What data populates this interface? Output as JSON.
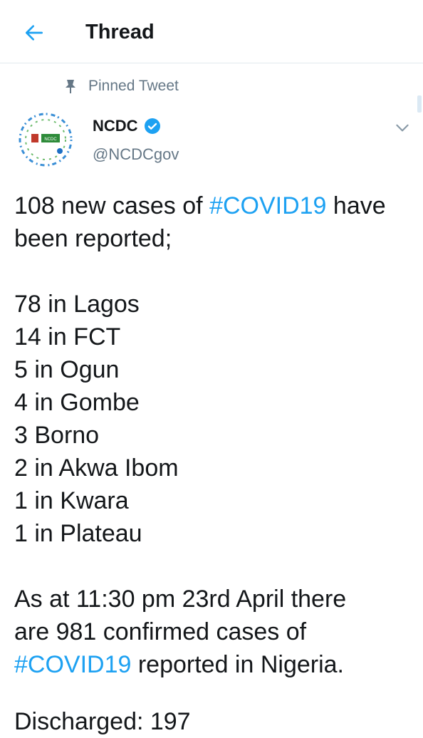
{
  "header": {
    "title": "Thread"
  },
  "pinned": {
    "label": "Pinned Tweet"
  },
  "tweet": {
    "author_name": "NCDC",
    "handle": "@NCDCgov",
    "avatar_text": "NCDC",
    "l1_a": "108 new cases of ",
    "l1_tag": "#COVID19",
    "l1_b": " have",
    "l2": "been reported;",
    "l3": "78 in Lagos",
    "l4": "14 in FCT",
    "l5": "5 in Ogun",
    "l6": "4 in Gombe",
    "l7": "3 Borno",
    "l8": "2 in Akwa Ibom",
    "l9": "1 in Kwara",
    "l10": "1 in Plateau",
    "l11": "As at 11:30 pm 23rd April there",
    "l12": "are 981 confirmed cases of",
    "l13_tag": "#COVID19",
    "l13_b": " reported in Nigeria.",
    "cut": "Discharged: 197"
  },
  "colors": {
    "accent": "#1da1f2",
    "muted": "#657786",
    "text": "#14171a"
  },
  "icons": {
    "back": "arrow-left-icon",
    "pin": "pin-icon",
    "verified": "verified-badge-icon",
    "menu": "chevron-down-icon"
  }
}
